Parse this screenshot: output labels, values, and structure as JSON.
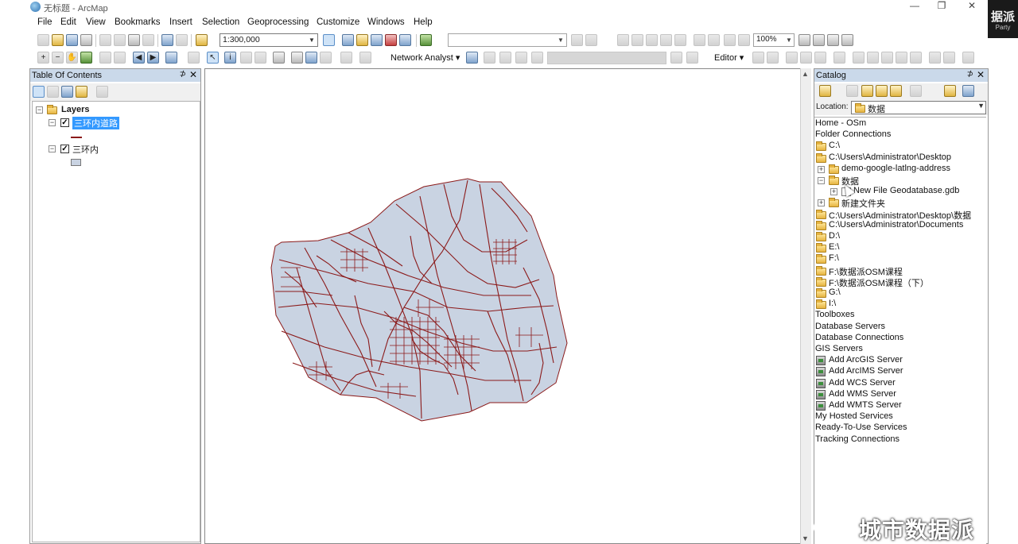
{
  "window": {
    "title": "无标题 - ArcMap",
    "controls": [
      "—",
      "❐",
      "✕"
    ],
    "brand_text": "据派",
    "brand_sub": "Party"
  },
  "menu": [
    "File",
    "Edit",
    "View",
    "Bookmarks",
    "Insert",
    "Selection",
    "Geoprocessing",
    "Customize",
    "Windows",
    "Help"
  ],
  "toolbar": {
    "scale": "1:300,000",
    "zoom_percent": "100%",
    "network_analyst_label": "Network Analyst ▾",
    "editor_label": "Editor ▾"
  },
  "toc": {
    "title": "Table Of Contents",
    "pin": "⊅",
    "close": "✕",
    "root_label": "Layers",
    "layers": [
      {
        "name": "三环内道路",
        "checked": true,
        "selected": true,
        "symbol": "line",
        "symbol_color": "#8b1a1a"
      },
      {
        "name": "三环内",
        "checked": true,
        "selected": false,
        "symbol": "polygon",
        "symbol_color": "#c9d3e2"
      }
    ]
  },
  "map": {
    "polygon_fill": "#c9d3e2",
    "road_color": "#8b1a1a"
  },
  "catalog": {
    "title": "Catalog",
    "location_label": "Location:",
    "location_value": "数据",
    "items": [
      {
        "label": "Home - OSm",
        "icon": "none",
        "indent": 0
      },
      {
        "label": "Folder Connections",
        "icon": "none",
        "indent": 0
      },
      {
        "label": "C:\\",
        "icon": "folder",
        "indent": 1
      },
      {
        "label": "C:\\Users\\Administrator\\Desktop",
        "icon": "folder",
        "indent": 1
      },
      {
        "label": "demo-google-latlng-address",
        "icon": "folder",
        "indent": 2,
        "expander": "+"
      },
      {
        "label": "数据",
        "icon": "folder",
        "indent": 2,
        "expander": "−"
      },
      {
        "label": "New File Geodatabase.gdb",
        "icon": "gdb",
        "indent": 3,
        "expander": "+"
      },
      {
        "label": "新建文件夹",
        "icon": "folder",
        "indent": 2,
        "expander": "+"
      },
      {
        "label": "C:\\Users\\Administrator\\Desktop\\数据",
        "icon": "folder",
        "indent": 1
      },
      {
        "label": "C:\\Users\\Administrator\\Documents",
        "icon": "folder",
        "indent": 1
      },
      {
        "label": "D:\\",
        "icon": "folder",
        "indent": 1
      },
      {
        "label": "E:\\",
        "icon": "folder",
        "indent": 1
      },
      {
        "label": "F:\\",
        "icon": "folder",
        "indent": 1
      },
      {
        "label": "F:\\数据派OSM课程",
        "icon": "folder",
        "indent": 1
      },
      {
        "label": "F:\\数据派OSM课程（下）",
        "icon": "folder",
        "indent": 1
      },
      {
        "label": "G:\\",
        "icon": "folder",
        "indent": 1
      },
      {
        "label": "I:\\",
        "icon": "folder",
        "indent": 1
      },
      {
        "label": "Toolboxes",
        "icon": "none",
        "indent": 0
      },
      {
        "label": "Database Servers",
        "icon": "none",
        "indent": 0
      },
      {
        "label": "Database Connections",
        "icon": "none",
        "indent": 0
      },
      {
        "label": "GIS Servers",
        "icon": "none",
        "indent": 0
      },
      {
        "label": "Add ArcGIS Server",
        "icon": "server",
        "indent": 1
      },
      {
        "label": "Add ArcIMS Server",
        "icon": "server",
        "indent": 1
      },
      {
        "label": "Add WCS Server",
        "icon": "server",
        "indent": 1
      },
      {
        "label": "Add WMS Server",
        "icon": "server",
        "indent": 1
      },
      {
        "label": "Add WMTS Server",
        "icon": "server",
        "indent": 1
      },
      {
        "label": "My Hosted Services",
        "icon": "none",
        "indent": 0
      },
      {
        "label": "Ready-To-Use Services",
        "icon": "none",
        "indent": 0
      },
      {
        "label": "Tracking Connections",
        "icon": "none",
        "indent": 0
      }
    ]
  },
  "watermark": {
    "text": "城市数据派"
  }
}
